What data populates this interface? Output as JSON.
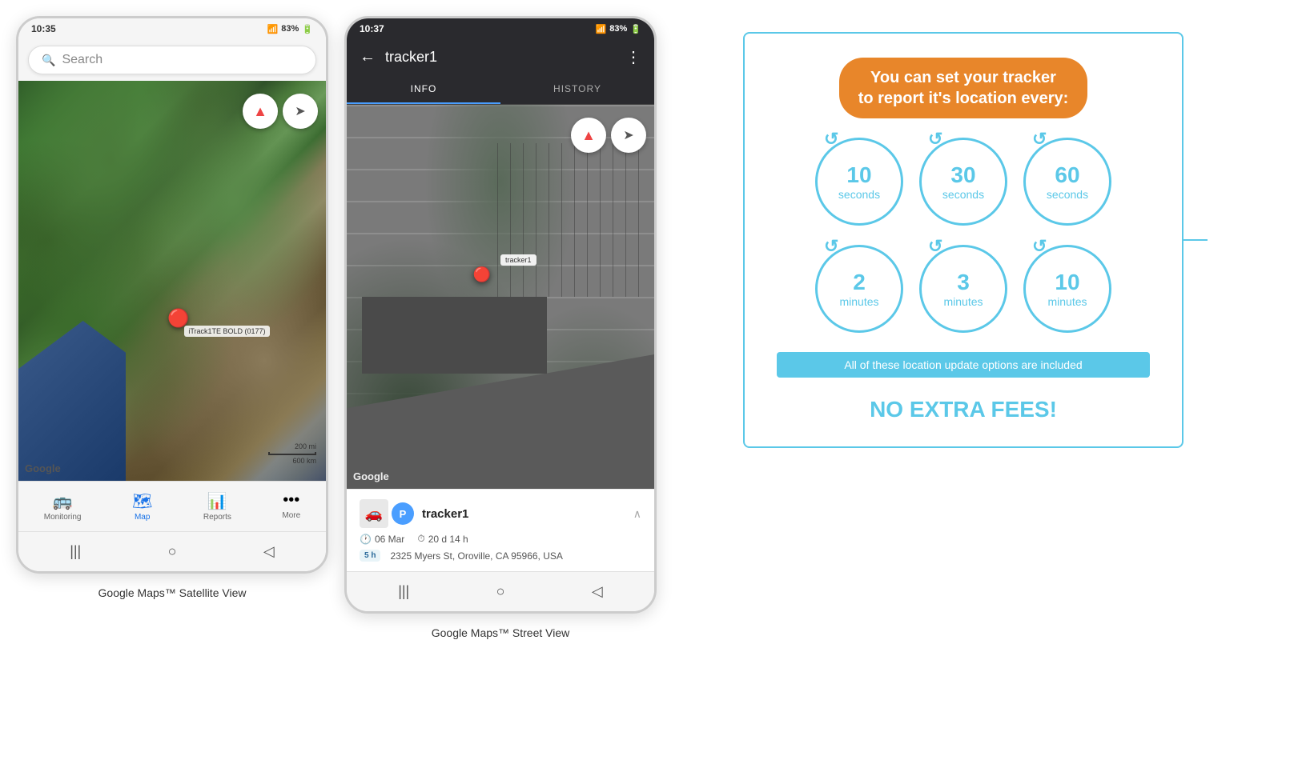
{
  "page": {
    "bg_color": "#ffffff"
  },
  "phone1": {
    "status_time": "10:35",
    "status_signal": "▲▲▲",
    "status_battery": "83%",
    "search_placeholder": "Search",
    "compass_icon": "⬆",
    "location_icon": "➤",
    "tracker_label": "iTrack1TE BOLD (0177)",
    "google_label": "Google",
    "scale_200mi": "200 mi",
    "scale_600km": "600 km",
    "nav_items": [
      {
        "icon": "🚌",
        "label": "Monitoring",
        "active": false
      },
      {
        "icon": "🗺",
        "label": "Map",
        "active": true
      },
      {
        "icon": "📊",
        "label": "Reports",
        "active": false
      },
      {
        "icon": "•••",
        "label": "More",
        "active": false
      }
    ],
    "bottom_btns": [
      "|||",
      "○",
      "◁"
    ],
    "caption": "Google Maps™ Satellite View"
  },
  "phone2": {
    "status_time": "10:37",
    "status_signal": "▲▲▲",
    "status_battery": "83%",
    "back_icon": "←",
    "tracker_name": "tracker1",
    "more_icon": "⋮",
    "tabs": [
      {
        "label": "INFO",
        "active": true
      },
      {
        "label": "HISTORY",
        "active": false
      }
    ],
    "compass_icon": "⬆",
    "location_icon": "➤",
    "google_label": "Google",
    "tracker_popup": "tracker1",
    "card": {
      "name": "tracker1",
      "date": "06 Mar",
      "duration": "20 d 14 h",
      "address": "2325 Myers St, Oroville, CA 95966, USA",
      "badge": "5 h"
    },
    "bottom_btns": [
      "|||",
      "○",
      "◁"
    ],
    "caption": "Google Maps™ Street View"
  },
  "info": {
    "title": "You can set your tracker\nto report it's location every:",
    "intervals_row1": [
      {
        "number": "10",
        "unit": "seconds"
      },
      {
        "number": "30",
        "unit": "seconds"
      },
      {
        "number": "60",
        "unit": "seconds"
      }
    ],
    "intervals_row2": [
      {
        "number": "2",
        "unit": "minutes"
      },
      {
        "number": "3",
        "unit": "minutes"
      },
      {
        "number": "10",
        "unit": "minutes"
      }
    ],
    "included_text": "All of these location update options are included",
    "no_fees": "NO EXTRA FEES!",
    "accent_color": "#e8862a",
    "blue_color": "#5bc8e8"
  }
}
